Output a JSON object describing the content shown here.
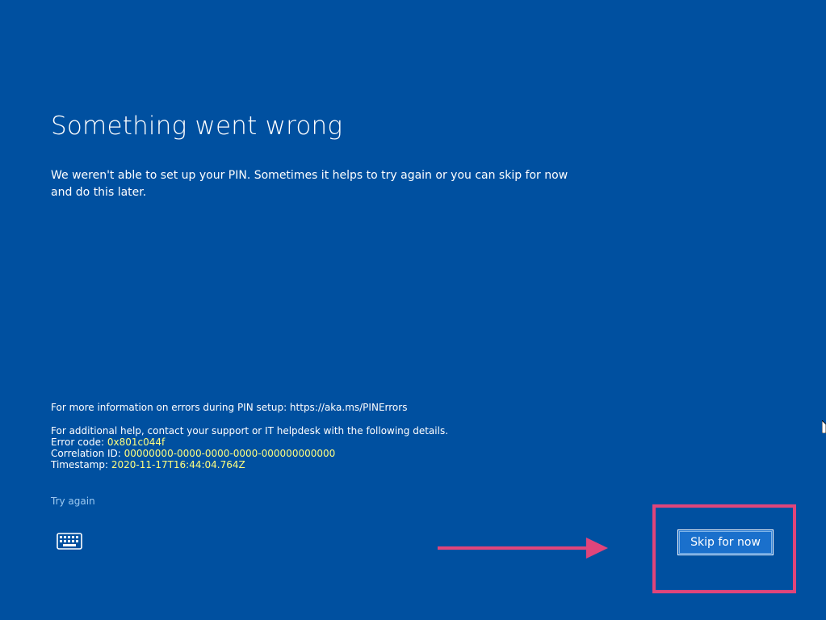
{
  "title": "Something went wrong",
  "message": "We weren't able to set up your PIN. Sometimes it helps to try again or you can skip for now and do this later.",
  "info": {
    "more_info": "For more information on errors during PIN setup: https://aka.ms/PINErrors",
    "additional_help": "For additional help, contact your support or IT helpdesk with the following details.",
    "error_code_label": "Error code: ",
    "error_code_value": "0x801c044f",
    "correlation_label": "Correlation ID: ",
    "correlation_value": "00000000-0000-0000-0000-000000000000",
    "timestamp_label": "Timestamp: ",
    "timestamp_value": "2020-11-17T16:44:04.764Z"
  },
  "actions": {
    "try_again": "Try again",
    "skip": "Skip for now"
  },
  "icons": {
    "keyboard": "keyboard-icon",
    "arrow": "right-arrow-annotation"
  },
  "colors": {
    "background": "#0050a0",
    "value_highlight": "#ffff7f",
    "link": "#9cc9f0",
    "annotation": "#e0457b",
    "button": "#1a70cc"
  }
}
